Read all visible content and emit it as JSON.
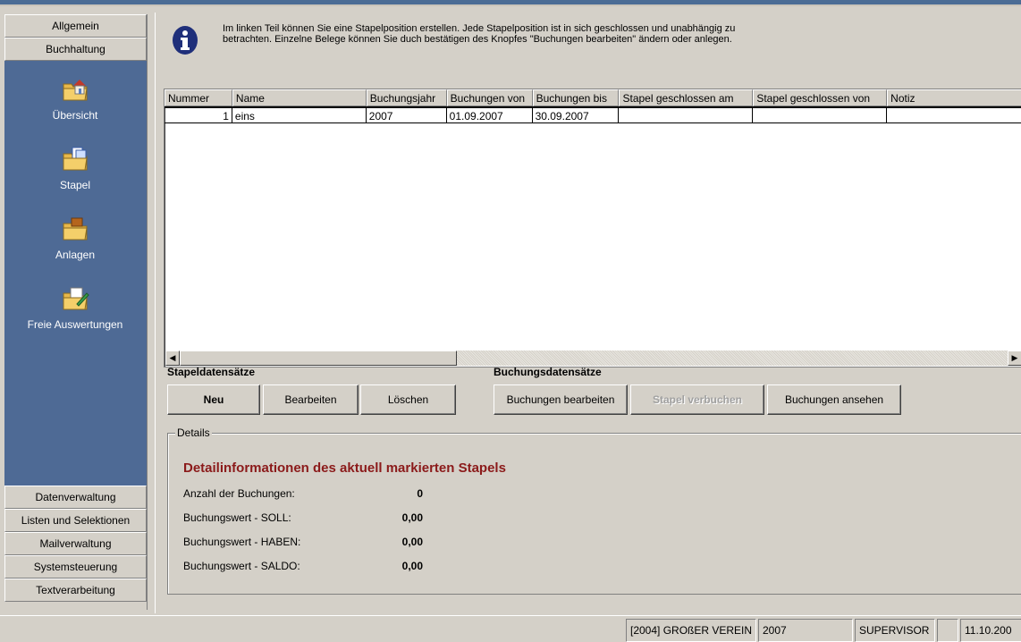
{
  "outlook": {
    "top_groups": [
      "Allgemein",
      "Buchhaltung"
    ],
    "pane_items": [
      {
        "label": "Übersicht",
        "icon": "folder-home-icon"
      },
      {
        "label": "Stapel",
        "icon": "folder-docs-icon"
      },
      {
        "label": "Anlagen",
        "icon": "folder-briefcase-icon"
      },
      {
        "label": "Freie Auswertungen",
        "icon": "folder-edit-icon"
      }
    ],
    "bottom_groups": [
      "Datenverwaltung",
      "Listen und Selektionen",
      "Mailverwaltung",
      "Systemsteuerung",
      "Textverarbeitung"
    ]
  },
  "info": {
    "text": "Im linken Teil können Sie eine Stapelposition erstellen. Jede Stapelposition ist in sich geschlossen und unabhängig zu betrachten. Einzelne Belege können Sie duch bestätigen des Knopfes \"Buchungen bearbeiten\" ändern oder anlegen."
  },
  "grid": {
    "columns": [
      "Nummer",
      "Name",
      "Buchungsjahr",
      "Buchungen von",
      "Buchungen bis",
      "Stapel geschlossen am",
      "Stapel geschlossen von",
      "Notiz"
    ],
    "rows": [
      [
        "1",
        "eins",
        "2007",
        "01.09.2007",
        "30.09.2007",
        "",
        "",
        ""
      ]
    ]
  },
  "sections": {
    "stapel": "Stapeldatensätze",
    "buchung": "Buchungsdatensätze"
  },
  "buttons": {
    "neu": "Neu",
    "bearbeiten": "Bearbeiten",
    "loeschen": "Löschen",
    "buchungen_bearbeiten": "Buchungen bearbeiten",
    "stapel_verbuchen": "Stapel verbuchen",
    "buchungen_ansehen": "Buchungen ansehen"
  },
  "details": {
    "legend": "Details",
    "title": "Detailinformationen des aktuell markierten Stapels",
    "rows": [
      {
        "label": "Anzahl der Buchungen:",
        "value": "0"
      },
      {
        "label": "Buchungswert - SOLL:",
        "value": "0,00"
      },
      {
        "label": "Buchungswert - HABEN:",
        "value": "0,00"
      },
      {
        "label": "Buchungswert - SALDO:",
        "value": "0,00"
      }
    ]
  },
  "status": {
    "verein": "[2004] GROßER VEREIN",
    "jahr": "2007",
    "user": "SUPERVISOR",
    "empty": "",
    "date": "11.10.200"
  },
  "colors": {
    "pane": "#4e6a95",
    "detail_title": "#8b1a1a"
  }
}
